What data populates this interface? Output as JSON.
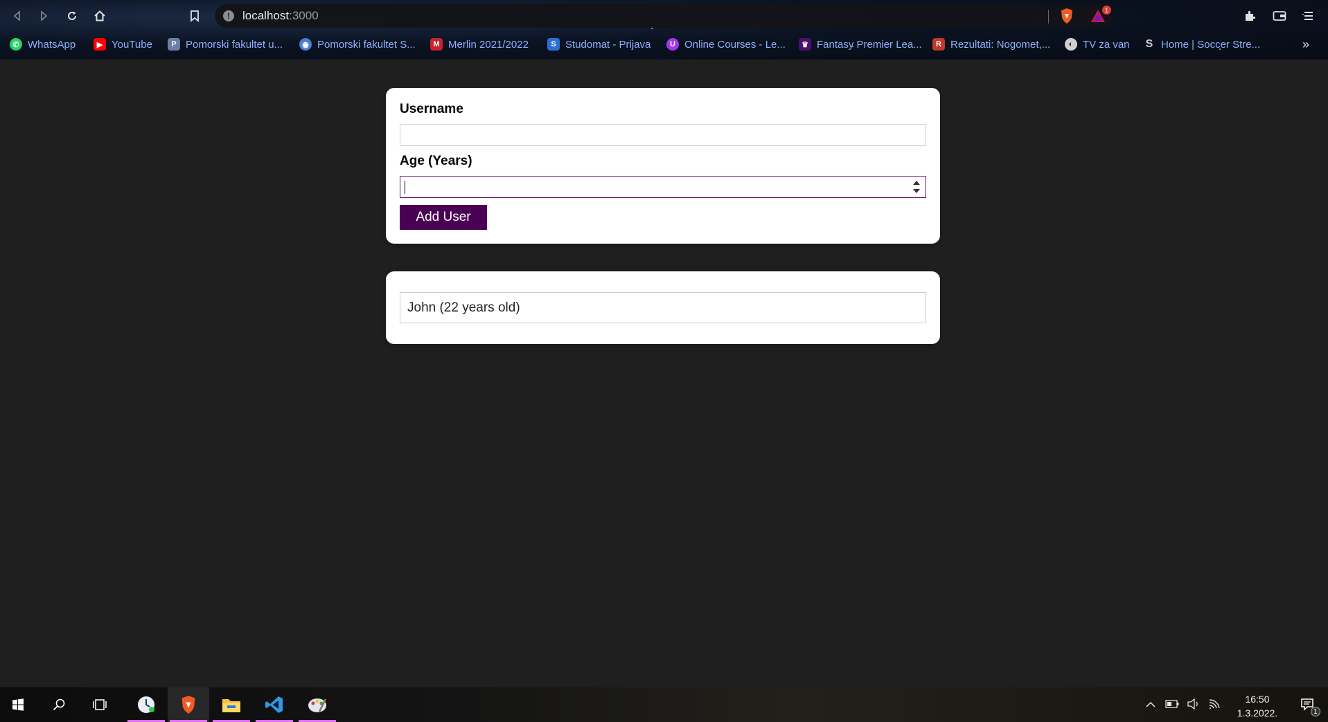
{
  "browser": {
    "url_host": "localhost",
    "url_port": ":3000",
    "shield_badge": "1",
    "bookmarks": [
      {
        "label": "WhatsApp",
        "icon": "whatsapp-icon",
        "color": "#25d366"
      },
      {
        "label": "YouTube",
        "icon": "youtube-icon",
        "color": "#ff0000"
      },
      {
        "label": "Pomorski fakultet u...",
        "icon": "faculty-icon",
        "color": "#6a7ea8"
      },
      {
        "label": "Pomorski fakultet S...",
        "icon": "globe-icon",
        "color": "#4a7fcf"
      },
      {
        "label": "Merlin 2021/2022",
        "icon": "merlin-icon",
        "color": "#c8232c"
      },
      {
        "label": "Studomat - Prijava",
        "icon": "studomat-icon",
        "color": "#2a6fd6"
      },
      {
        "label": "Online Courses - Le...",
        "icon": "udemy-icon",
        "color": "#a435f0"
      },
      {
        "label": "Fantasy Premier Lea...",
        "icon": "premier-league-icon",
        "color": "#4b0f6b"
      },
      {
        "label": "Rezultati: Nogomet,...",
        "icon": "results-icon",
        "color": "#c0392b"
      },
      {
        "label": "TV za van",
        "icon": "globe-icon",
        "color": "#d0d0d0"
      },
      {
        "label": "Home | Soccer Stre...",
        "icon": "soccer-icon",
        "color": "#d0d0d0"
      }
    ]
  },
  "form": {
    "username_label": "Username",
    "username_value": "",
    "age_label": "Age (Years)",
    "age_value": "",
    "submit_label": "Add User"
  },
  "users": {
    "items": [
      "John (22 years old)"
    ]
  },
  "taskbar": {
    "time": "16:50",
    "date": "1.3.2022.",
    "notification_count": "1"
  },
  "colors": {
    "accent": "#4a0054",
    "page_bg": "#1f1f1f"
  }
}
